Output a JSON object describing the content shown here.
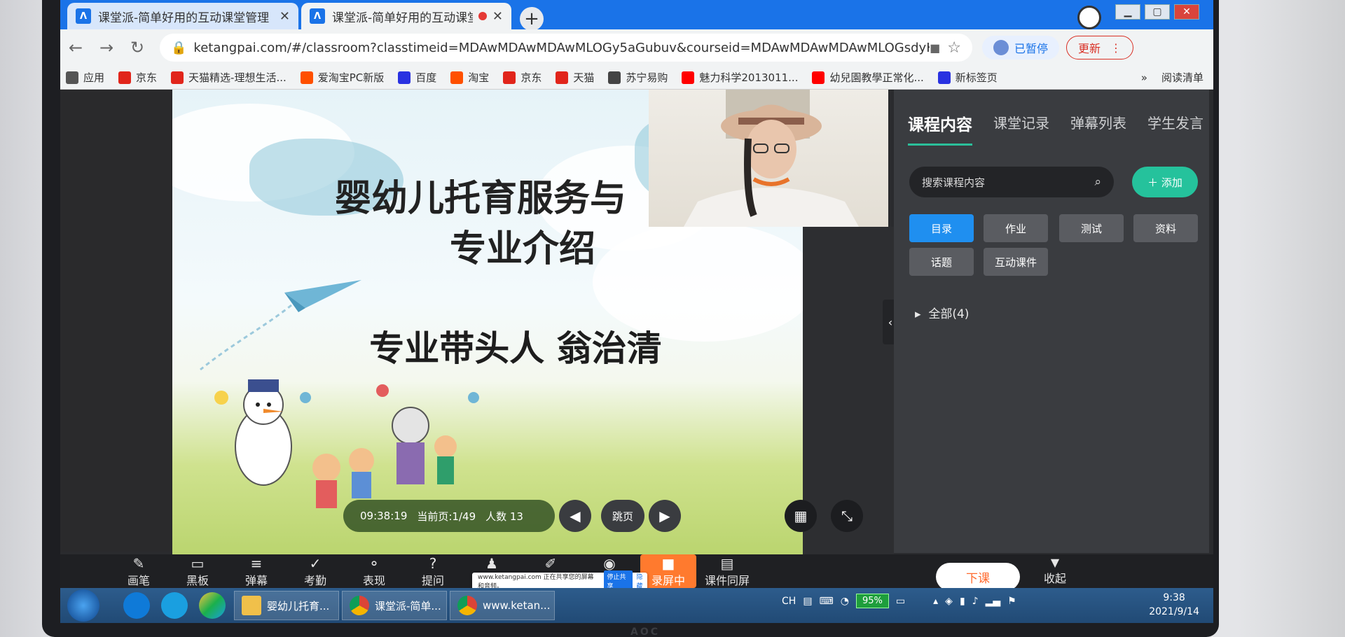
{
  "browser": {
    "tabs": [
      {
        "title": "课堂派-简单好用的互动课堂管理",
        "active": false
      },
      {
        "title": "课堂派-简单好用的互动课堂",
        "active": true
      }
    ],
    "url": "ketangpai.com/#/classroom?classtimeid=MDAwMDAwMDAwMLOGy5aGubuv&courseid=MDAwMDAwMDAwMLOGsdyH36-vhctyo...",
    "paused_label": "已暂停",
    "update_label": "更新",
    "bookmarks": [
      {
        "label": "应用",
        "icon": "apps-grid-icon",
        "color": "#555555"
      },
      {
        "label": "京东",
        "icon": "jd-icon",
        "color": "#e1251b"
      },
      {
        "label": "天猫精选-理想生活...",
        "icon": "tmall-icon",
        "color": "#e1251b"
      },
      {
        "label": "爱淘宝PC新版",
        "icon": "taobao-icon",
        "color": "#ff5000"
      },
      {
        "label": "百度",
        "icon": "baidu-paw-icon",
        "color": "#2932e1"
      },
      {
        "label": "淘宝",
        "icon": "taobao-icon",
        "color": "#ff5000"
      },
      {
        "label": "京东",
        "icon": "jd-icon",
        "color": "#e1251b"
      },
      {
        "label": "天猫",
        "icon": "tmall-icon",
        "color": "#e1251b"
      },
      {
        "label": "苏宁易购",
        "icon": "globe-icon",
        "color": "#444444"
      },
      {
        "label": "魅力科学2013011...",
        "icon": "youtube-icon",
        "color": "#ff0000"
      },
      {
        "label": "幼兒園教學正常化...",
        "icon": "youtube-icon",
        "color": "#ff0000"
      },
      {
        "label": "新标签页",
        "icon": "baidu-paw-icon",
        "color": "#2932e1"
      }
    ],
    "more_label": "»",
    "reading_list_label": "阅读清单"
  },
  "slide": {
    "title_line1": "婴幼儿托育服务与",
    "title_line2": "专业介绍",
    "subtitle": "专业带头人 翁治清",
    "time": "09:38:19",
    "page": "当前页:1/49",
    "people": "人数 13",
    "jump_label": "跳页"
  },
  "panel": {
    "tabs": [
      "课程内容",
      "课堂记录",
      "弹幕列表",
      "学生发言"
    ],
    "search_placeholder": "搜索课程内容",
    "add_label": "添加",
    "chips": [
      "目录",
      "作业",
      "测试",
      "资料",
      "话题",
      "互动课件"
    ],
    "tree_root": "全部(4)"
  },
  "toolbar": {
    "tools": [
      "画笔",
      "黑板",
      "弹幕",
      "考勤",
      "表现",
      "提问",
      "抢答",
      "编辑互动",
      "摄像头",
      "录屏中",
      "课件同屏"
    ],
    "end_label": "下课",
    "collapse_label": "收起",
    "share_note": "www.ketangpai.com 正在共享您的屏幕和音频。",
    "share_stop": "停止共享",
    "share_hide": "隐藏"
  },
  "taskbar": {
    "tasks": [
      "婴幼儿托育...",
      "课堂派-简单...",
      "www.ketan..."
    ],
    "lang": "CH",
    "battery": "95%",
    "time": "9:38",
    "date": "2021/9/14"
  },
  "colors": {
    "accent": "#25c29c",
    "chip_active": "#1f8ff0",
    "recording": "#ff7a2e",
    "browser_blue": "#1a73e8"
  }
}
